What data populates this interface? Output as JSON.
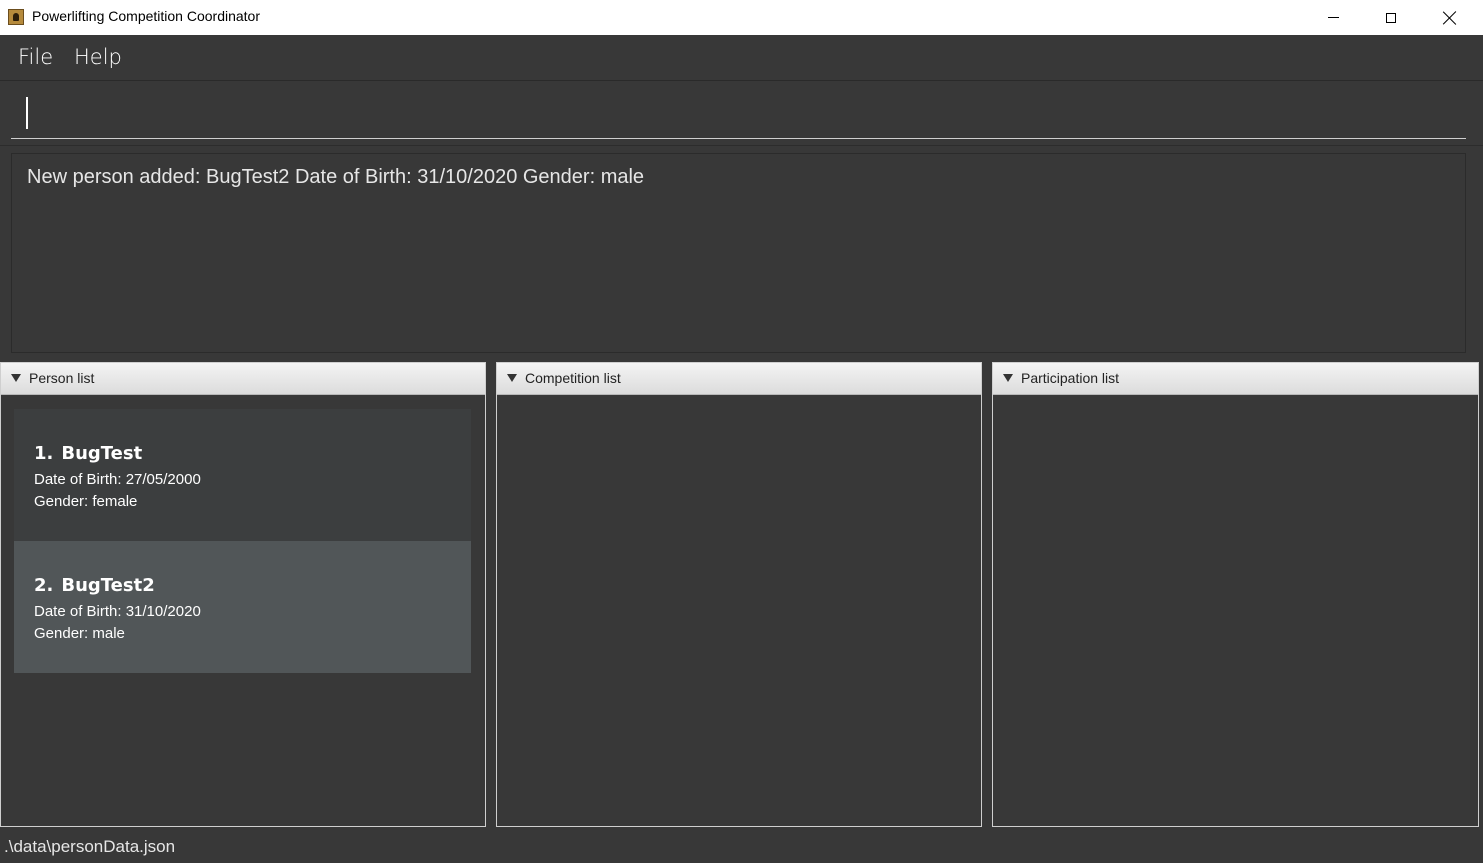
{
  "window": {
    "title": "Powerlifting Competition Coordinator"
  },
  "menu": {
    "file": "File",
    "help": "Help"
  },
  "command_box": {
    "value": "",
    "placeholder": ""
  },
  "result_display": {
    "message": "New person added: BugTest2 Date of Birth: 31/10/2020 Gender: male"
  },
  "panels": {
    "person": {
      "title": "Person list",
      "items": [
        {
          "index": "1.",
          "name": "BugTest",
          "dob": "Date of Birth: 27/05/2000",
          "gender": "Gender: female"
        },
        {
          "index": "2.",
          "name": "BugTest2",
          "dob": "Date of Birth: 31/10/2020",
          "gender": "Gender: male"
        }
      ]
    },
    "competition": {
      "title": "Competition list"
    },
    "participation": {
      "title": "Participation list"
    }
  },
  "status_bar": {
    "path": ".\\data\\personData.json"
  },
  "colors": {
    "background": "#383838",
    "card_selected": "#515658",
    "card_default": "#3c3e3f"
  }
}
